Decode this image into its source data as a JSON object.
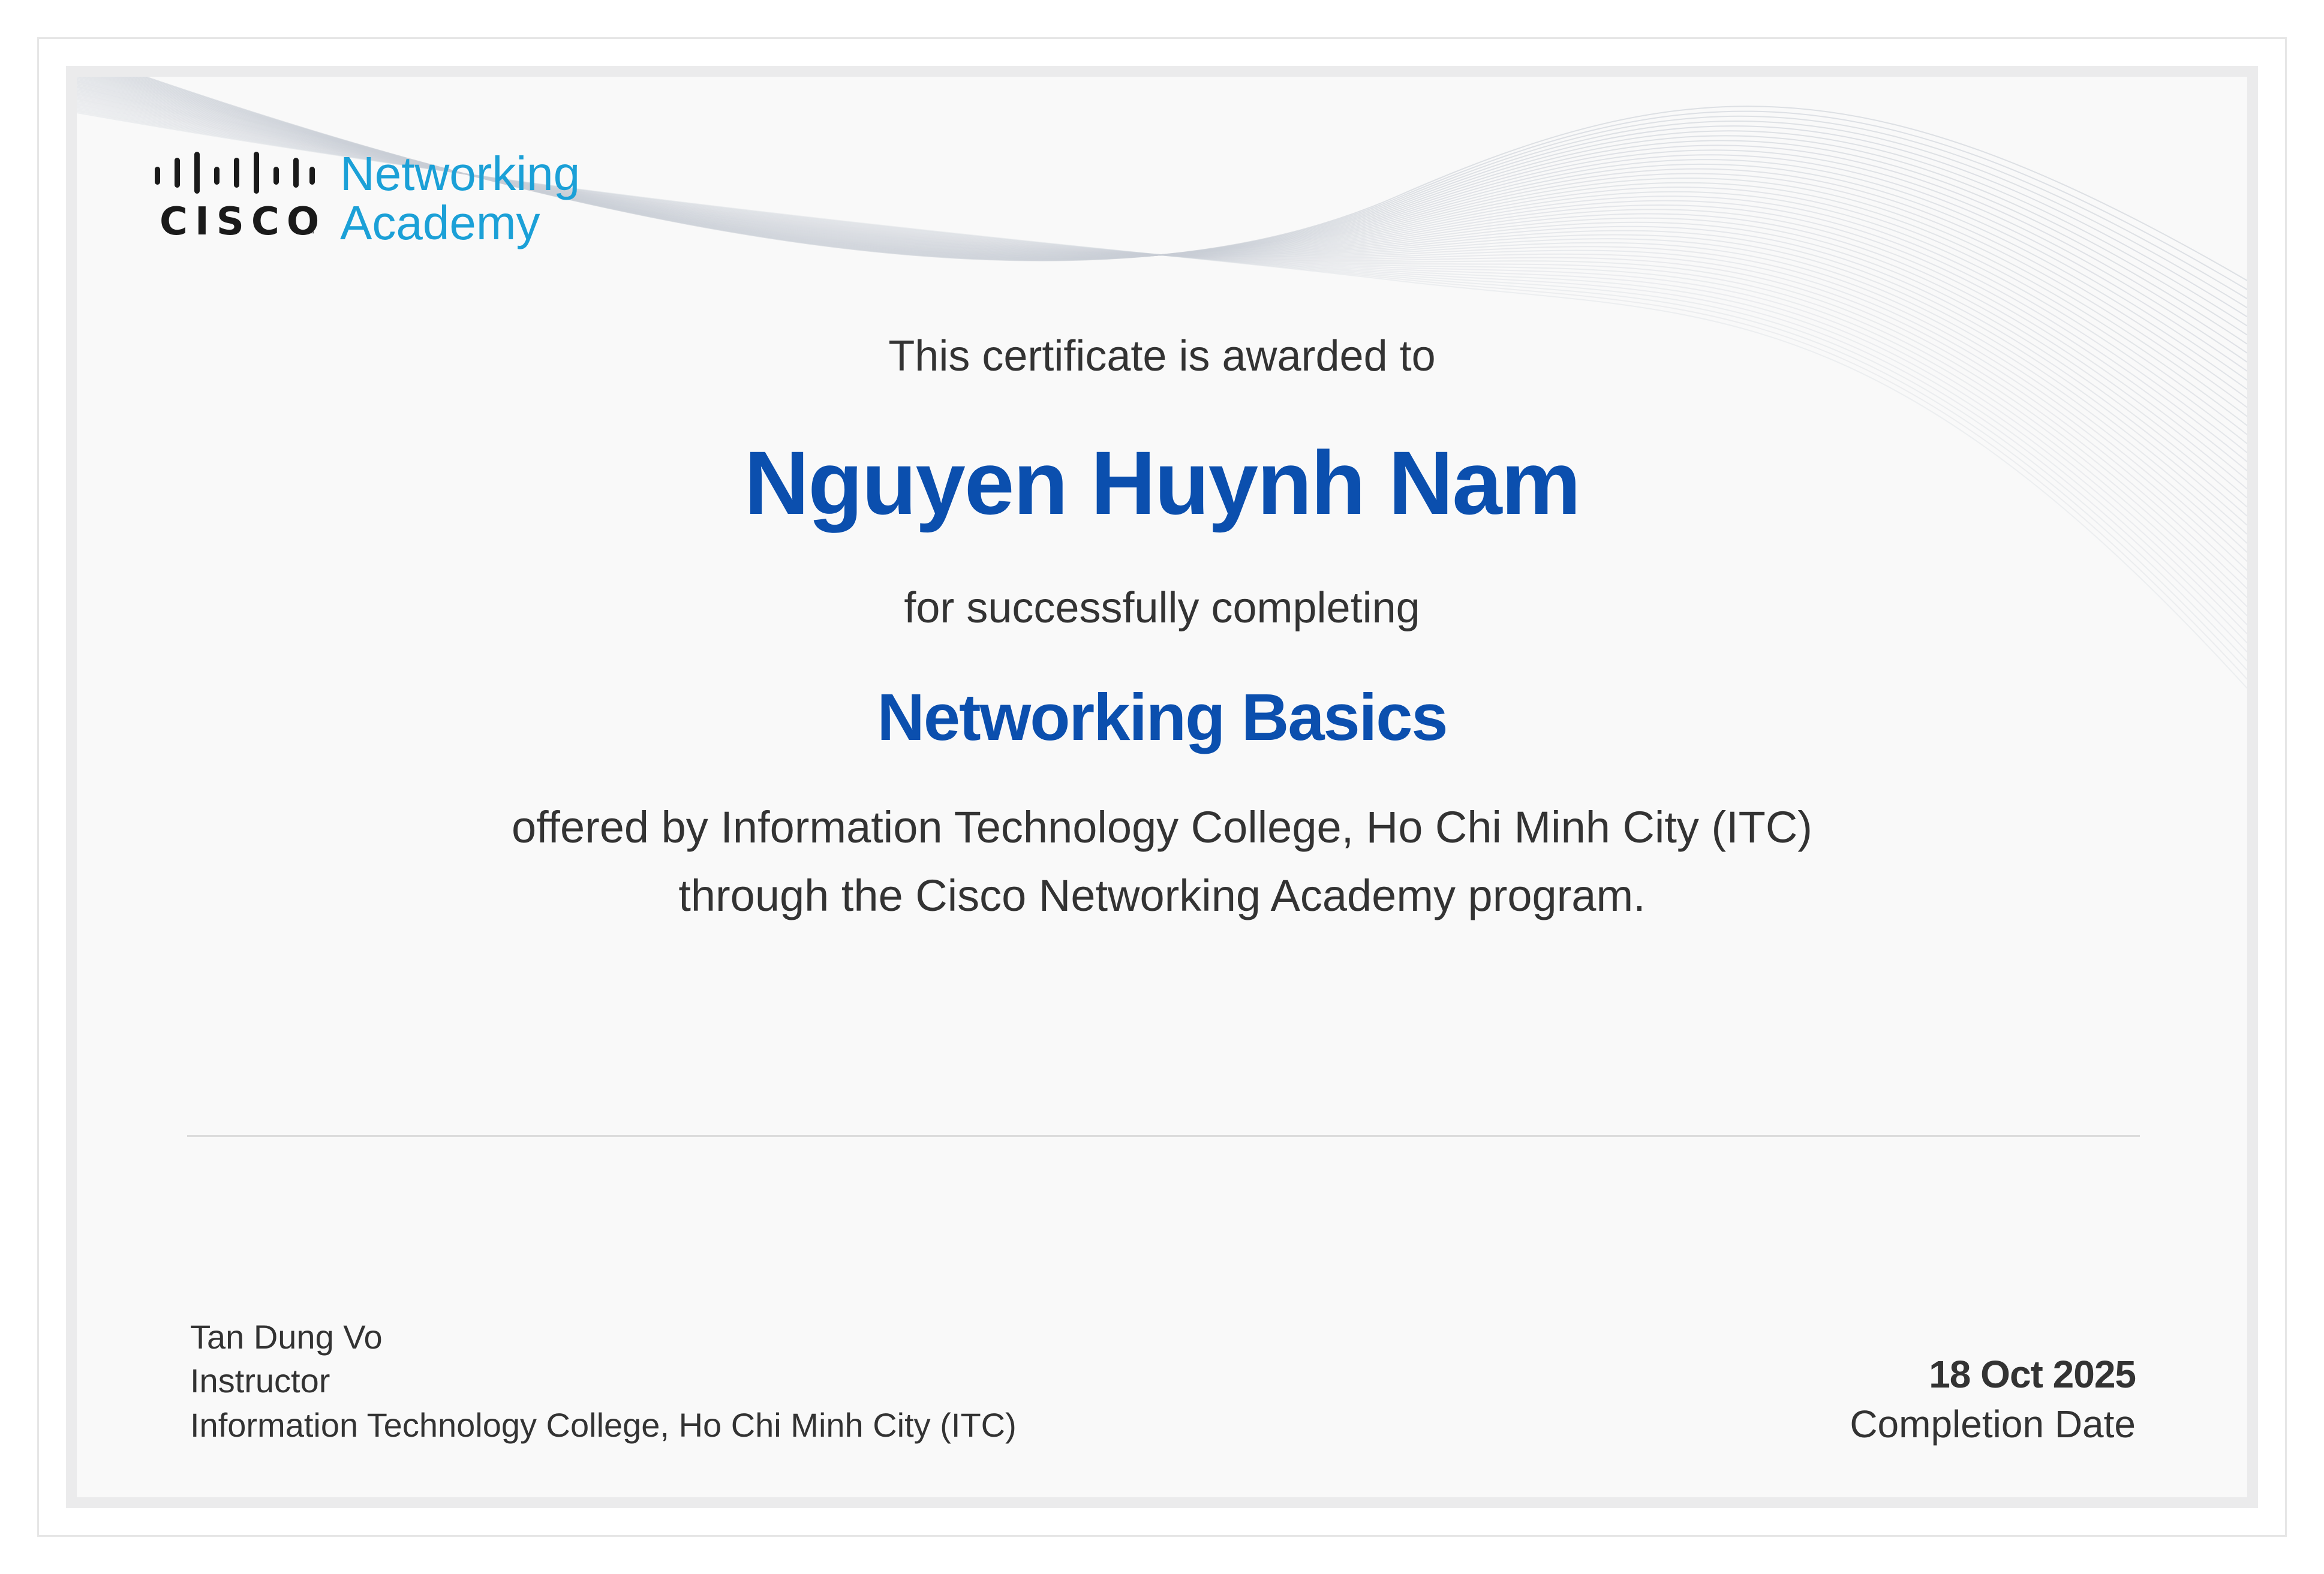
{
  "logo": {
    "brand": "CISCO",
    "program_line1": "Networking",
    "program_line2": "Academy",
    "icon": "cisco-bars-icon"
  },
  "certificate": {
    "awarded_text": "This certificate is awarded to",
    "recipient_name": "Nguyen Huynh Nam",
    "completing_text": "for successfully completing",
    "course_name": "Networking Basics",
    "offered_line": "offered by Information Technology College, Ho Chi Minh City (ITC)",
    "program_line": "through the Cisco Networking Academy program."
  },
  "signature": {
    "name": "Tan Dung Vo",
    "role": "Instructor",
    "organization": "Information Technology College, Ho Chi Minh City (ITC)"
  },
  "completion": {
    "date": "18 Oct 2025",
    "label": "Completion Date"
  },
  "colors": {
    "accent_blue": "#0b4fae",
    "logo_blue": "#1ba0d7",
    "text": "#333333",
    "frame": "#ebebec"
  }
}
